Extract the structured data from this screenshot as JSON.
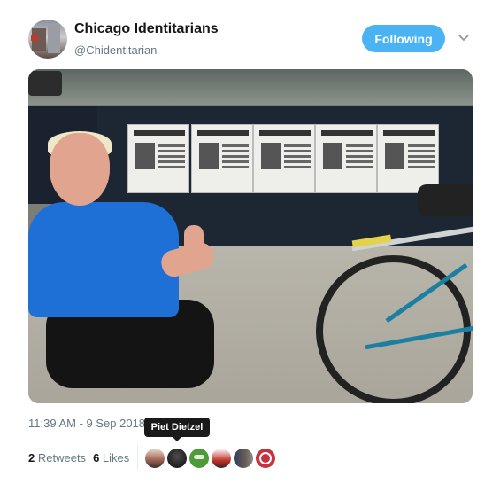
{
  "tweet": {
    "author_name": "Chicago Identitarians",
    "author_handle": "@Chidentitarian",
    "follow_label": "Following",
    "timestamp": "11:39 AM - 9 Sep 2018",
    "tooltip": "Piet Dietzel",
    "retweets_count": "2",
    "retweets_label": "Retweets",
    "likes_count": "6",
    "likes_label": "Likes"
  },
  "icons": {
    "caret": "chevron-down-icon"
  },
  "colors": {
    "accent": "#4ab3f4",
    "text": "#14171a",
    "muted": "#657786"
  }
}
